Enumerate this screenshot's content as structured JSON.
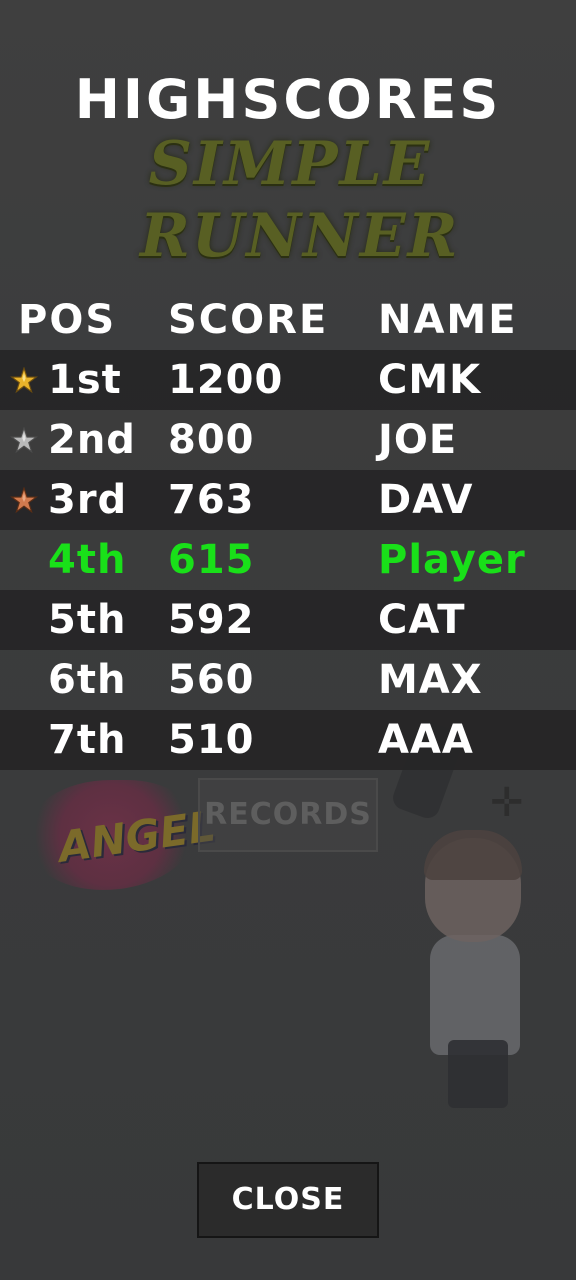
{
  "title": "HIGHSCORES",
  "background": {
    "logo_line1": "SIMPLE",
    "logo_line2": "RUNNER",
    "graffiti_text": "ANGEL",
    "records_label": "RECORDS"
  },
  "table": {
    "headers": {
      "pos": "POS",
      "score": "SCORE",
      "name": "NAME"
    },
    "rows": [
      {
        "pos": "1st",
        "score": "1200",
        "name": "CMK",
        "medal": "gold-star-icon",
        "medal_color": "#e8b22a"
      },
      {
        "pos": "2nd",
        "score": "800",
        "name": "JOE",
        "medal": "silver-star-icon",
        "medal_color": "#b9b9b9"
      },
      {
        "pos": "3rd",
        "score": "763",
        "name": "DAV",
        "medal": "bronze-star-icon",
        "medal_color": "#d27a4e"
      },
      {
        "pos": "4th",
        "score": "615",
        "name": "Player",
        "highlight": true
      },
      {
        "pos": "5th",
        "score": "592",
        "name": "CAT"
      },
      {
        "pos": "6th",
        "score": "560",
        "name": "MAX"
      },
      {
        "pos": "7th",
        "score": "510",
        "name": "AAA"
      }
    ]
  },
  "colors": {
    "highlight": "#19e019",
    "text": "#ffffff"
  },
  "close_label": "CLOSE"
}
